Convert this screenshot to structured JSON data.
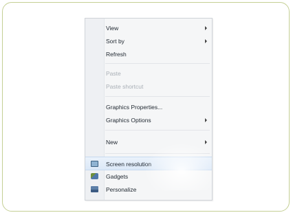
{
  "menu": {
    "items": [
      {
        "label": "View",
        "type": "submenu"
      },
      {
        "label": "Sort by",
        "type": "submenu"
      },
      {
        "label": "Refresh",
        "type": "item"
      },
      {
        "type": "separator"
      },
      {
        "label": "Paste",
        "type": "disabled"
      },
      {
        "label": "Paste shortcut",
        "type": "disabled"
      },
      {
        "type": "separator"
      },
      {
        "label": "Graphics Properties...",
        "type": "item"
      },
      {
        "label": "Graphics Options",
        "type": "submenu"
      },
      {
        "type": "separator"
      },
      {
        "label": "New",
        "type": "submenu"
      },
      {
        "type": "separator"
      },
      {
        "label": "Screen resolution",
        "type": "item",
        "icon": "screen-resolution-icon",
        "highlighted": true
      },
      {
        "label": "Gadgets",
        "type": "item",
        "icon": "gadgets-icon"
      },
      {
        "label": "Personalize",
        "type": "item",
        "icon": "personalize-icon"
      }
    ]
  },
  "colors": {
    "frame_border": "#c4cf94",
    "menu_background": "#f5f6f7",
    "highlight": "#dbe8f7"
  }
}
